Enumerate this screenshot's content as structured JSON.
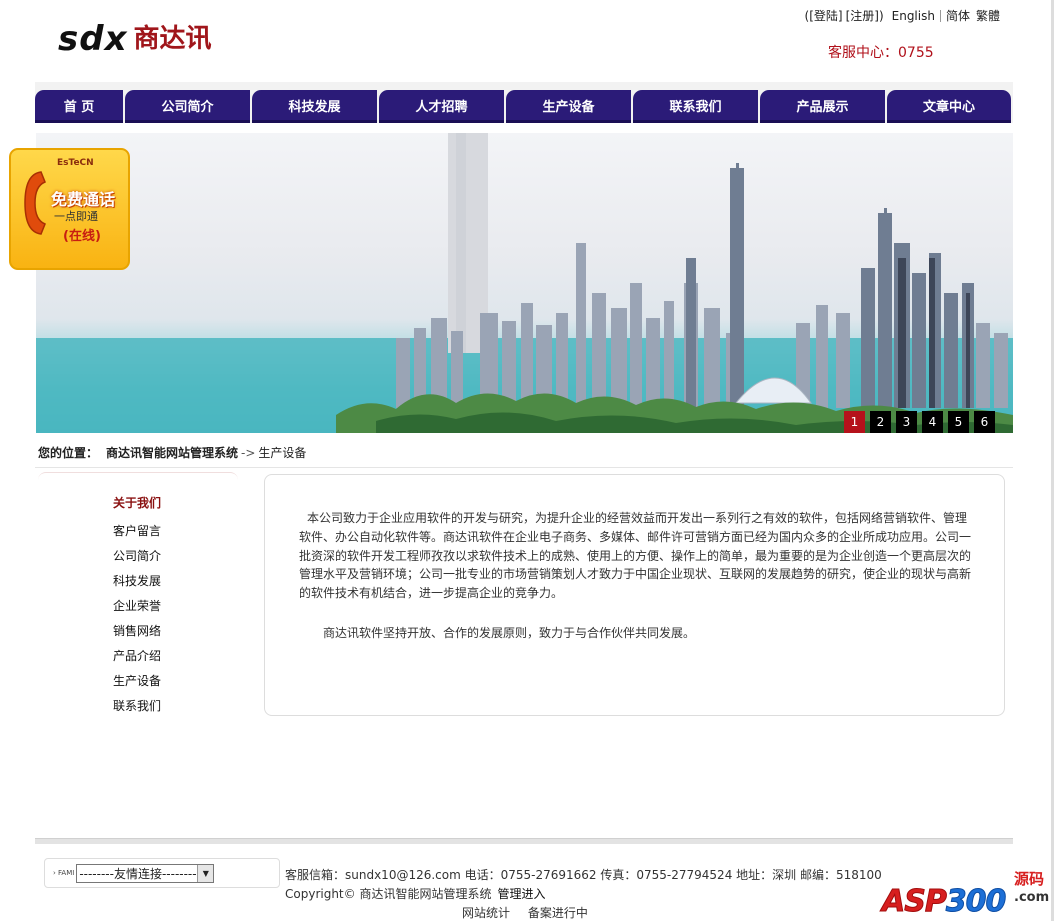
{
  "header": {
    "logo_sdx": "sdx",
    "logo_cn": "商达讯",
    "login": "[登陆]",
    "register": "[注册]",
    "close_paren": ")",
    "open_paren": "(",
    "english": "English",
    "simplified": "简体",
    "traditional": "繁體",
    "hotline": "客服中心：0755"
  },
  "nav": [
    {
      "label": "首  页"
    },
    {
      "label": "公司简介"
    },
    {
      "label": "科技发展"
    },
    {
      "label": "人才招聘"
    },
    {
      "label": "生产设备"
    },
    {
      "label": "联系我们"
    },
    {
      "label": "产品展示"
    },
    {
      "label": "文章中心"
    }
  ],
  "banner": {
    "slides": [
      "1",
      "2",
      "3",
      "4",
      "5",
      "6"
    ],
    "active_slide": "1"
  },
  "callbox": {
    "brand": "EsTeCN",
    "free": "免费通话",
    "one_click": "一点即通",
    "online": "(在线)"
  },
  "breadcrumb": {
    "label": "您的位置：",
    "home": "商达讯智能网站管理系统",
    "arrow": "->",
    "current": "生产设备"
  },
  "sidebar": {
    "title": "关于我们",
    "items": [
      "客户留言",
      "公司简介",
      "科技发展",
      "企业荣誉",
      "销售网络",
      "产品介绍",
      "生产设备",
      "联系我们"
    ]
  },
  "content": {
    "para1": "本公司致力于企业应用软件的开发与研究，为提升企业的经营效益而开发出一系列行之有效的软件，包括网络营销软件、管理软件、办公自动化软件等。商达讯软件在企业电子商务、多媒体、邮件许可营销方面已经为国内众多的企业所成功应用。公司一批资深的软件开发工程师孜孜以求软件技术上的成熟、使用上的方便、操作上的简单，最为重要的是为企业创造一个更高层次的管理水平及营销环境；公司一批专业的市场营销策划人才致力于中国企业现状、互联网的发展趋势的研究，使企业的现状与高新的软件技术有机结合，进一步提高企业的竞争力。",
    "para2": "商达讯软件坚持开放、合作的发展原则，致力于与合作伙伴共同发展。"
  },
  "footer": {
    "friend_tag": "› FAMI",
    "friend_select": "--------友情连接--------",
    "line1": "客服信箱：sundx10@126.com 电话：0755-27691662 传真：0755-27794524 地址：深圳 邮编：518100",
    "line2": "Copyright© 商达讯智能网站管理系统",
    "admin": "管理进入",
    "stats": "网站统计",
    "icp": "备案进行中"
  },
  "watermark": {
    "asp": "ASP",
    "num": "300",
    "yuan": "源码",
    "com": ".com"
  },
  "colors": {
    "nav_bg": "#2b1b78",
    "accent_red": "#b0101a",
    "active_slide": "#b5121b",
    "sidebar_title": "#8a1111"
  }
}
